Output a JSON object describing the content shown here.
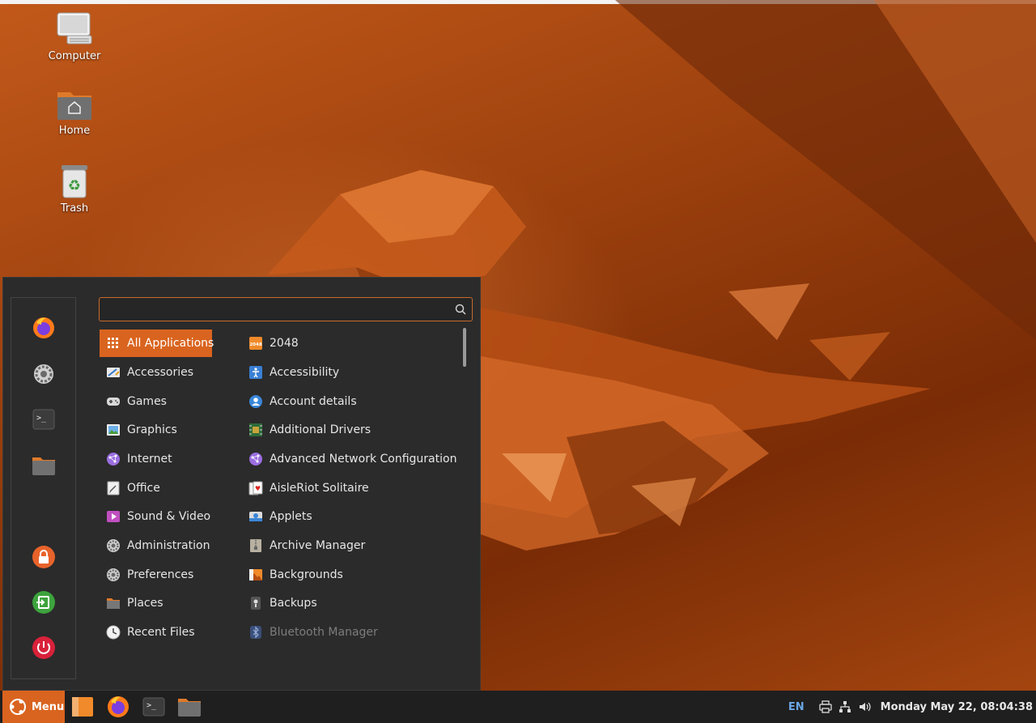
{
  "desktop": {
    "icons": [
      {
        "label": "Computer",
        "icon": "computer-icon"
      },
      {
        "label": "Home",
        "icon": "home-folder-icon"
      },
      {
        "label": "Trash",
        "icon": "trash-icon"
      }
    ]
  },
  "menu": {
    "search": {
      "value": "",
      "placeholder": ""
    },
    "favorites": [
      {
        "icon": "firefox-icon"
      },
      {
        "icon": "settings-icon"
      },
      {
        "icon": "terminal-icon"
      },
      {
        "icon": "folder-icon"
      },
      {
        "icon": "lock-screen-icon"
      },
      {
        "icon": "logout-icon"
      },
      {
        "icon": "power-icon"
      }
    ],
    "categories": [
      {
        "label": "All Applications",
        "icon": "grid-icon",
        "selected": true
      },
      {
        "label": "Accessories",
        "icon": "accessories-icon"
      },
      {
        "label": "Games",
        "icon": "gamepad-icon"
      },
      {
        "label": "Graphics",
        "icon": "graphics-icon"
      },
      {
        "label": "Internet",
        "icon": "internet-icon"
      },
      {
        "label": "Office",
        "icon": "office-icon"
      },
      {
        "label": "Sound & Video",
        "icon": "media-icon"
      },
      {
        "label": "Administration",
        "icon": "admin-gear-icon"
      },
      {
        "label": "Preferences",
        "icon": "preferences-gear-icon"
      },
      {
        "label": "Places",
        "icon": "places-folder-icon"
      },
      {
        "label": "Recent Files",
        "icon": "clock-icon"
      }
    ],
    "apps": [
      {
        "label": "2048",
        "icon": "game-2048-icon"
      },
      {
        "label": "Accessibility",
        "icon": "accessibility-icon"
      },
      {
        "label": "Account details",
        "icon": "account-icon"
      },
      {
        "label": "Additional Drivers",
        "icon": "chip-icon"
      },
      {
        "label": "Advanced Network Configuration",
        "icon": "network-config-icon"
      },
      {
        "label": "AisleRiot Solitaire",
        "icon": "cards-icon"
      },
      {
        "label": "Applets",
        "icon": "applets-icon"
      },
      {
        "label": "Archive Manager",
        "icon": "archive-icon"
      },
      {
        "label": "Backgrounds",
        "icon": "backgrounds-icon"
      },
      {
        "label": "Backups",
        "icon": "backups-icon"
      },
      {
        "label": "Bluetooth Manager",
        "icon": "bluetooth-icon",
        "disabled": true
      }
    ]
  },
  "panel": {
    "menu_label": "Menu",
    "keyboard_layout": "EN",
    "clock": "Monday May 22, 08:04:38",
    "launchers": [
      {
        "icon": "show-desktop-icon"
      },
      {
        "icon": "firefox-icon"
      },
      {
        "icon": "terminal-icon"
      },
      {
        "icon": "files-icon"
      }
    ]
  },
  "colors": {
    "accent": "#d9641f",
    "menu_bg": "#2b2b2b",
    "panel_bg": "#1f1f1f",
    "keyboard_layout_text": "#6aa7e6"
  }
}
